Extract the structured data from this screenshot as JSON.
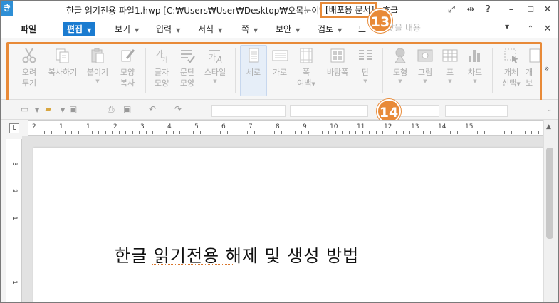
{
  "window": {
    "title": "한글 읽기전용 파일1.hwp [C:₩Users₩User₩Desktop₩오목눈이₩]",
    "badge": "[배포용 문서]",
    "app_name": "흥글",
    "controls": [
      "expand-icon",
      "split-icon",
      "?",
      "minimize",
      "maximize",
      "close"
    ]
  },
  "menu": {
    "items": [
      {
        "label": "파일",
        "arrow": false
      },
      {
        "label": "편집",
        "arrow": true,
        "active": true
      },
      {
        "label": "보기",
        "arrow": true
      },
      {
        "label": "입력",
        "arrow": true
      },
      {
        "label": "서식",
        "arrow": true
      },
      {
        "label": "쪽",
        "arrow": true
      },
      {
        "label": "보안",
        "arrow": true
      },
      {
        "label": "검토",
        "arrow": true
      },
      {
        "label": "도",
        "arrow": false
      }
    ],
    "search_placeholder": "찾을 내용"
  },
  "ribbon": {
    "buttons": [
      {
        "name": "cut",
        "label1": "오려",
        "label2": "두기",
        "icon": "scissors-icon"
      },
      {
        "name": "copy",
        "label1": "복사하기",
        "label2": "",
        "icon": "copy-icon"
      },
      {
        "name": "paste",
        "label1": "붙이기",
        "label2": "",
        "icon": "paste-icon",
        "dropdown": true
      },
      {
        "name": "format-copy",
        "label1": "모양",
        "label2": "복사",
        "icon": "brush-icon"
      },
      {
        "name": "char-shape",
        "label1": "글자",
        "label2": "모양",
        "icon": "char-shape-icon"
      },
      {
        "name": "para-shape",
        "label1": "문단",
        "label2": "모양",
        "icon": "para-shape-icon"
      },
      {
        "name": "style",
        "label1": "스타일",
        "label2": "",
        "icon": "style-icon",
        "dropdown": true
      },
      {
        "name": "portrait",
        "label1": "세로",
        "label2": "",
        "icon": "portrait-icon",
        "selected": true
      },
      {
        "name": "landscape",
        "label1": "가로",
        "label2": "",
        "icon": "landscape-icon"
      },
      {
        "name": "margins",
        "label1": "쪽",
        "label2": "여백",
        "icon": "margins-icon",
        "dropdown": true
      },
      {
        "name": "background",
        "label1": "바탕쪽",
        "label2": "",
        "icon": "background-icon"
      },
      {
        "name": "columns",
        "label1": "단",
        "label2": "",
        "icon": "columns-icon",
        "dropdown": true
      },
      {
        "name": "shape",
        "label1": "도형",
        "label2": "",
        "icon": "shape-icon",
        "dropdown": true
      },
      {
        "name": "picture",
        "label1": "그림",
        "label2": "",
        "icon": "picture-icon",
        "dropdown": true
      },
      {
        "name": "table",
        "label1": "표",
        "label2": "",
        "icon": "table-icon",
        "dropdown": true
      },
      {
        "name": "chart",
        "label1": "차트",
        "label2": "",
        "icon": "chart-icon",
        "dropdown": true
      },
      {
        "name": "object-select",
        "label1": "개체",
        "label2": "선택",
        "icon": "object-select-icon",
        "dropdown": true
      },
      {
        "name": "more",
        "label1": "개",
        "label2": "보",
        "icon": "more-icon"
      }
    ]
  },
  "callouts": {
    "a": "13",
    "b": "14"
  },
  "ruler": {
    "numbers": [
      "2",
      "1",
      "1",
      "2",
      "3",
      "4",
      "5",
      "6",
      "7",
      "8",
      "9",
      "10",
      "11",
      "12",
      "13",
      "14",
      "15"
    ]
  },
  "document": {
    "text": "한글 읽기전용 해제 및 생성 방법"
  },
  "colors": {
    "accent": "#1a7bd0",
    "callout": "#e88a38"
  }
}
